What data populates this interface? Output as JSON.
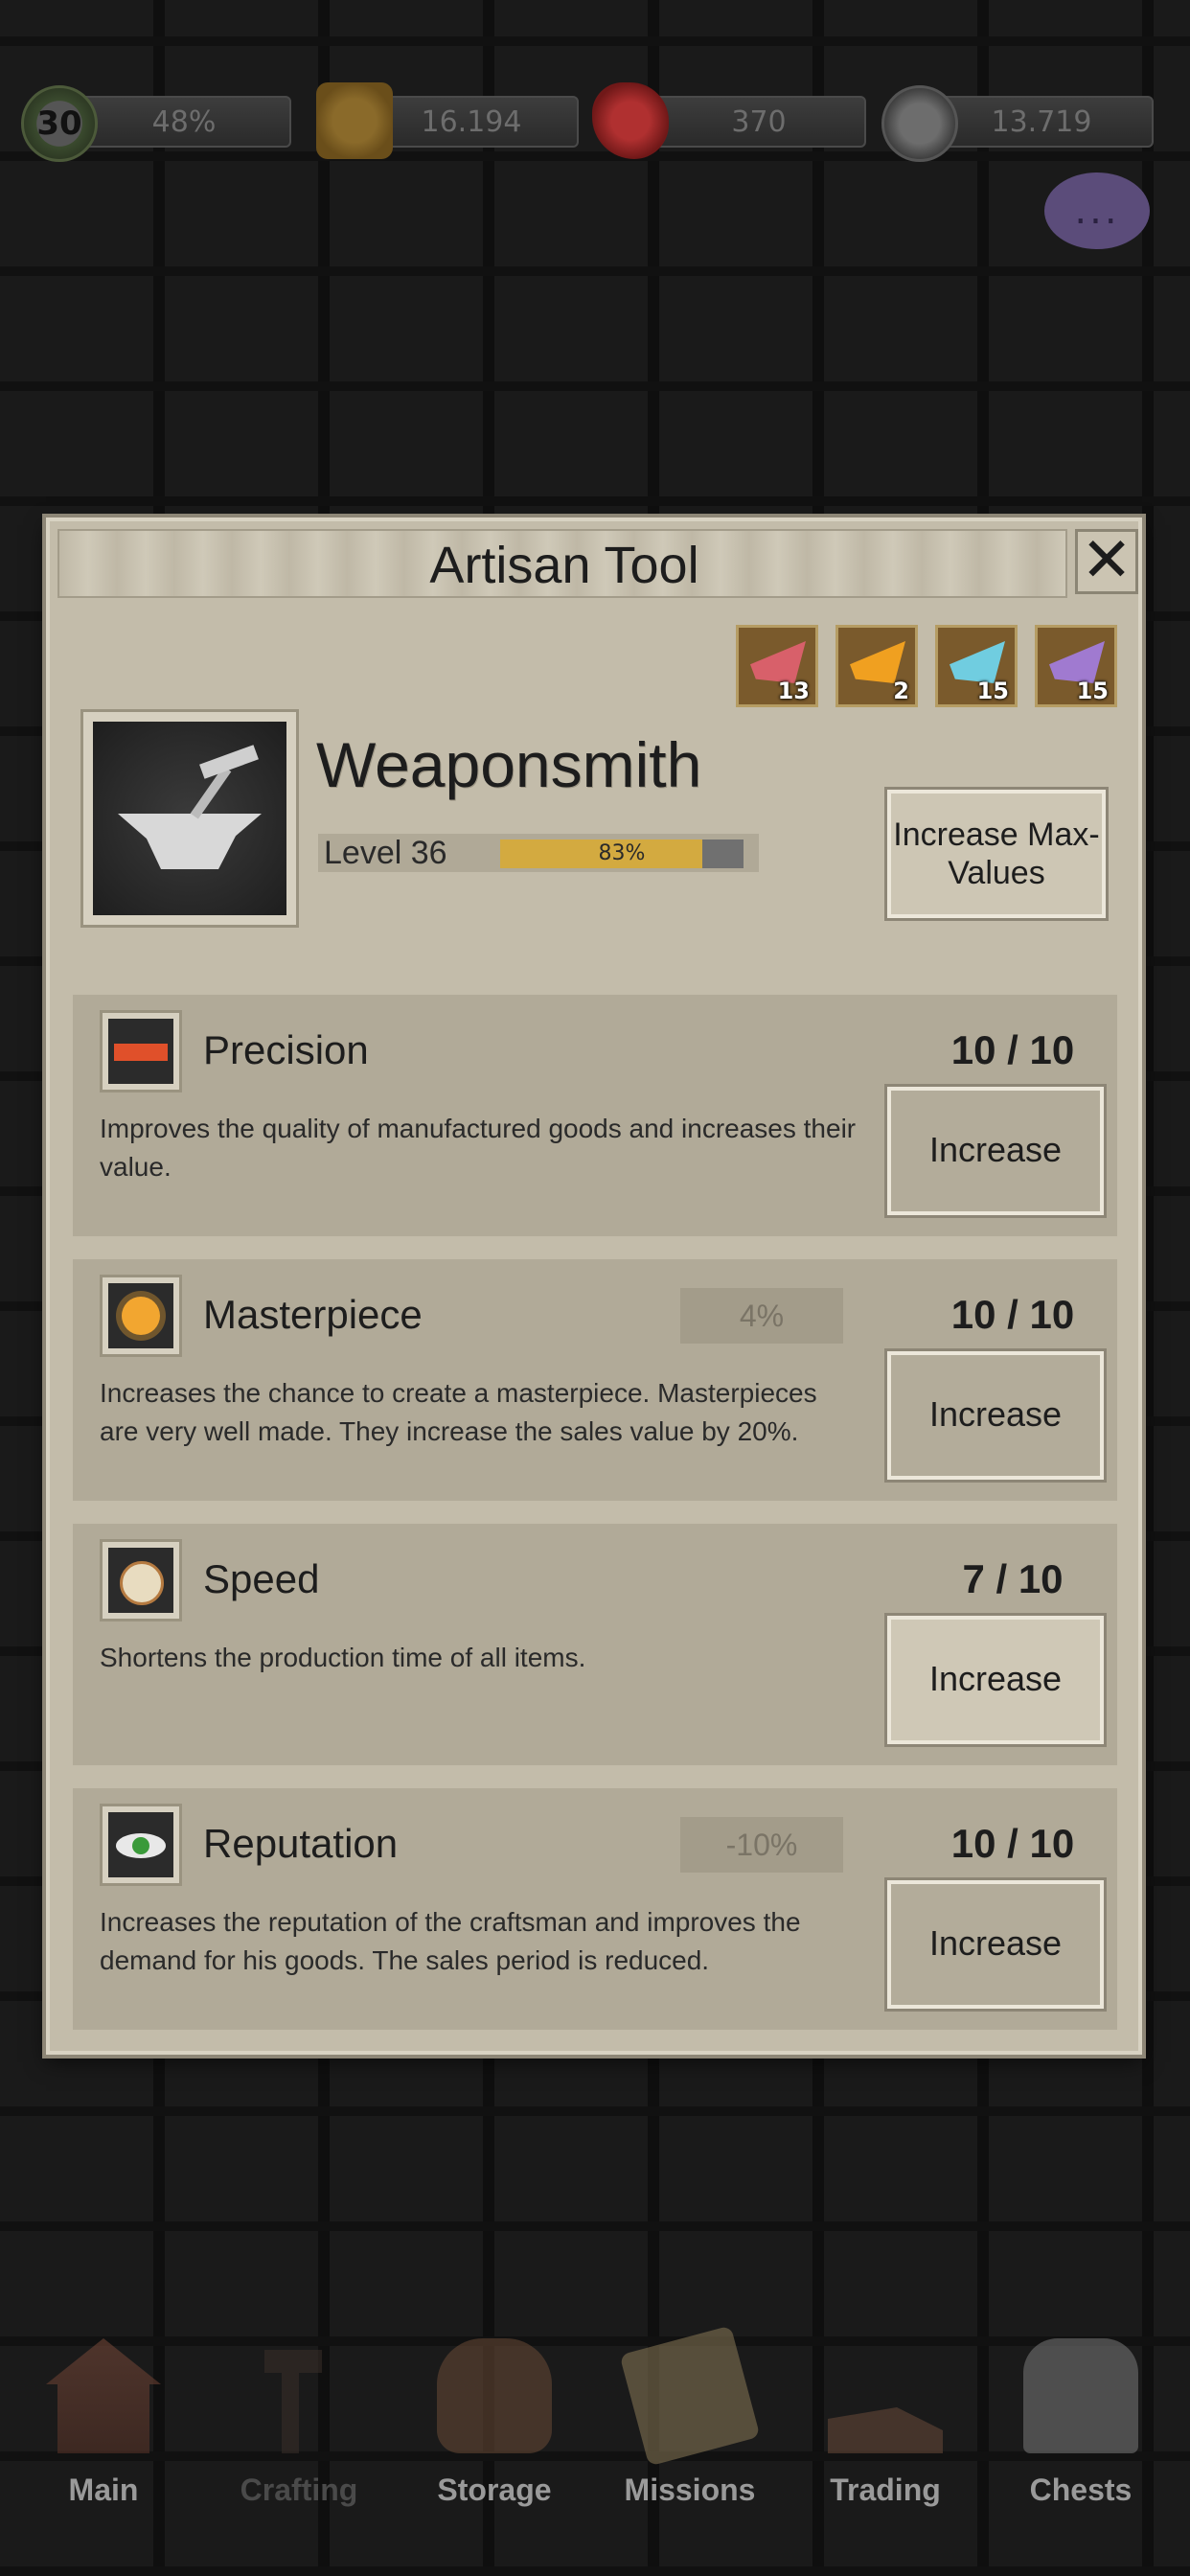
{
  "topbar": {
    "level": "30",
    "xp_percent": "48%",
    "coins": "16.194",
    "rubies": "370",
    "reputation": "13.719"
  },
  "chat": {
    "icon": "speech-bubble-icon",
    "text": "..."
  },
  "panel": {
    "title": "Artisan Tool",
    "close_label": "✕",
    "materials": [
      {
        "icon": "red-gem-shard-icon",
        "count": "13",
        "color": "#d8606a"
      },
      {
        "icon": "orange-gem-shard-icon",
        "count": "2",
        "color": "#f0a020"
      },
      {
        "icon": "cyan-gem-shard-icon",
        "count": "15",
        "color": "#70cde0"
      },
      {
        "icon": "purple-gem-shard-icon",
        "count": "15",
        "color": "#a07ad0"
      }
    ],
    "profession": {
      "name": "Weaponsmith",
      "icon": "anvil-icon",
      "level_label": "Level 36",
      "progress": 0.83,
      "progress_label": "83%",
      "max_button": "Increase Max-Values"
    },
    "skills": [
      {
        "name": "Precision",
        "icon": "ruler-icon",
        "count": "10 / 10",
        "percent": "",
        "description": "Improves the quality of manufactured goods and increases their value.",
        "button": "Increase",
        "maxed": true
      },
      {
        "name": "Masterpiece",
        "icon": "sun-icon",
        "count": "10 / 10",
        "percent": "4%",
        "description": "Increases the chance to create a masterpiece. Masterpieces are very well made. They increase the sales value by 20%.",
        "button": "Increase",
        "maxed": true
      },
      {
        "name": "Speed",
        "icon": "pocket-watch-icon",
        "count": "7 / 10",
        "percent": "",
        "description": "Shortens the production time of all items.",
        "button": "Increase",
        "maxed": false
      },
      {
        "name": "Reputation",
        "icon": "eye-icon",
        "count": "10 / 10",
        "percent": "-10%",
        "description": "Increases the reputation of the craftsman and improves the demand for his goods. The sales period is reduced.",
        "button": "Increase",
        "maxed": true
      }
    ]
  },
  "nav": [
    {
      "label": "Main",
      "icon": "house-icon"
    },
    {
      "label": "Crafting",
      "icon": "hammer-hand-icon"
    },
    {
      "label": "Storage",
      "icon": "backpack-icon"
    },
    {
      "label": "Missions",
      "icon": "scroll-map-icon"
    },
    {
      "label": "Trading",
      "icon": "coins-hand-icon"
    },
    {
      "label": "Chests",
      "icon": "treasure-chest-icon"
    }
  ],
  "colors": {
    "accent_progress": "#d3aa40",
    "panel_bg": "#c3bcaa",
    "card_bg": "#b1aa98"
  }
}
